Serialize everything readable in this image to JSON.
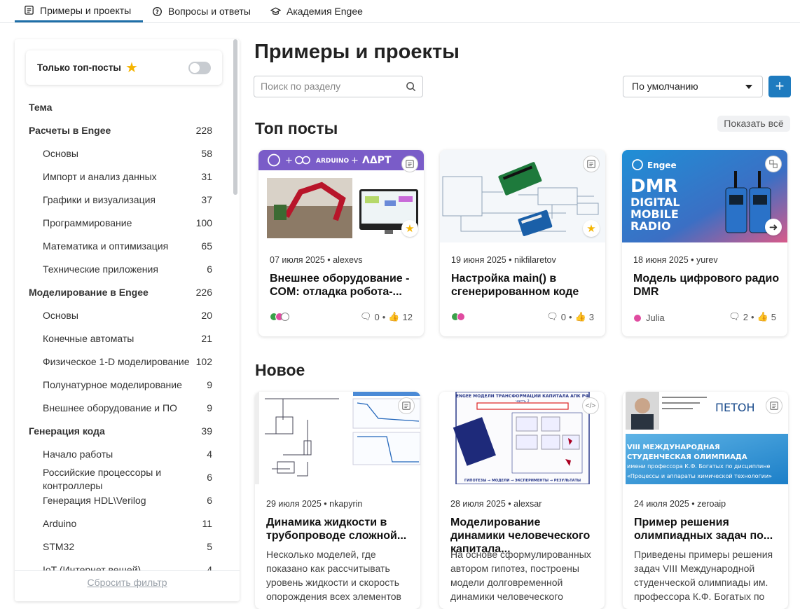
{
  "nav": {
    "tabs": [
      {
        "label": "Примеры и проекты",
        "active": true
      },
      {
        "label": "Вопросы и ответы"
      },
      {
        "label": "Академия Engee"
      }
    ]
  },
  "sidebar": {
    "top_toggle_label": "Только топ-посты",
    "theme_label": "Тема",
    "categories": [
      {
        "label": "Расчеты в Engee",
        "count": "228",
        "level": "top"
      },
      {
        "label": "Основы",
        "count": "58",
        "level": "sub"
      },
      {
        "label": "Импорт и анализ данных",
        "count": "31",
        "level": "sub"
      },
      {
        "label": "Графики и визуализация",
        "count": "37",
        "level": "sub"
      },
      {
        "label": "Программирование",
        "count": "100",
        "level": "sub"
      },
      {
        "label": "Математика и оптимизация",
        "count": "65",
        "level": "sub"
      },
      {
        "label": "Технические приложения",
        "count": "6",
        "level": "sub"
      },
      {
        "label": "Моделирование в Engee",
        "count": "226",
        "level": "top"
      },
      {
        "label": "Основы",
        "count": "20",
        "level": "sub"
      },
      {
        "label": "Конечные автоматы",
        "count": "21",
        "level": "sub"
      },
      {
        "label": "Физическое 1-D моделирование",
        "count": "102",
        "level": "sub"
      },
      {
        "label": "Полунатурное моделирование",
        "count": "9",
        "level": "sub"
      },
      {
        "label": "Внешнее оборудование и ПО",
        "count": "9",
        "level": "sub"
      },
      {
        "label": "Генерация кода",
        "count": "39",
        "level": "top"
      },
      {
        "label": "Начало работы",
        "count": "4",
        "level": "sub"
      },
      {
        "label": "Российские процессоры и контроллеры",
        "count": "6",
        "level": "sub"
      },
      {
        "label": "Генерация HDL\\Verilog",
        "count": "6",
        "level": "sub"
      },
      {
        "label": "Arduino",
        "count": "11",
        "level": "sub"
      },
      {
        "label": "STM32",
        "count": "5",
        "level": "sub"
      },
      {
        "label": "IoT (Интернет вещей)",
        "count": "4",
        "level": "sub"
      }
    ],
    "reset_label": "Сбросить фильтр"
  },
  "main": {
    "title": "Примеры и проекты",
    "search_placeholder": "Поиск по разделу",
    "sort_value": "По умолчанию",
    "add_label": "+",
    "top_section": "Топ посты",
    "show_all": "Показать всё",
    "new_section": "Новое",
    "top_posts": [
      {
        "date_author": "07 июля 2025 • alexevs",
        "title": "Внешнее оборудование - COM: отладка робота-...",
        "comments": "0",
        "likes": "12",
        "banner": "ARDUINO",
        "banner2": "ΛΔΡΤ"
      },
      {
        "date_author": "19 июня 2025 • nikfilaretov",
        "title": "Настройка main() в сгенерированном коде",
        "comments": "0",
        "likes": "3"
      },
      {
        "date_author": "18 июня 2025 • yurev",
        "title": "Модель цифрового радио DMR",
        "comments": "2",
        "likes": "5",
        "author_name": "Julia",
        "brand": "Engee",
        "big": "DMR",
        "sub1": "DIGITAL",
        "sub2": "MOBILE",
        "sub3": "RADIO"
      }
    ],
    "new_posts": [
      {
        "date_author": "29 июля 2025 • nkapyrin",
        "title": "Динамика жидкости в трубопроводе сложной...",
        "desc": "Несколько моделей, где показано как рассчитывать уровень жидкости и скорость опорождения всех элементов"
      },
      {
        "date_author": "28 июля 2025 • alexsar",
        "title": "Моделирование динамики человеческого капитала...",
        "desc": "На основе сформулированных автором гипотез, построены модели долговременной динамики человеческого",
        "poster_head": "ENGEE МОДЕЛИ ТРАНСФОРМАЦИИ КАПИТАЛА АПК РФ",
        "poster_part": "часть 2",
        "poster_foot": "ГИПОТЕЗЫ → МОДЕЛИ → ЭКСПЕРИМЕНТЫ → РЕЗУЛЬТАТЫ"
      },
      {
        "date_author": "24 июля 2025 • zeroaip",
        "title": "Пример решения олимпиадных задач по...",
        "desc": "Приведены примеры решения задач VIII Международной студенческой олимпиады  им. профессора К.Ф. Богатых по",
        "banner_logo": "ПЕТОН",
        "banner_line1": "VIII МЕЖДУНАРОДНАЯ",
        "banner_line2": "СТУДЕНЧЕСКАЯ ОЛИМПИАДА",
        "banner_line3": "имени профессора К.Ф. Богатых по дисциплине",
        "banner_line4": "«Процессы и аппараты химической технологии»"
      }
    ]
  },
  "colors": {
    "accent": "#1e7bbf",
    "star": "#f5b400",
    "arduino_banner": "#7a5cc8"
  }
}
